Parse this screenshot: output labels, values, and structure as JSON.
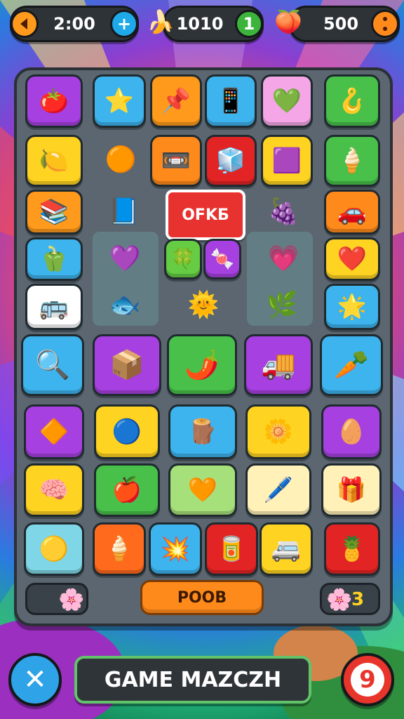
{
  "hud": {
    "timer": "2:00",
    "coins": "1010",
    "score": "500",
    "plus_symbol": "+",
    "coin_badge": "1"
  },
  "board": {
    "banner_text": "OFKБ",
    "play_button": "POOB",
    "counter_value": "3"
  },
  "footer": {
    "title": "GAME MAZCZH",
    "close_symbol": "✕",
    "right_value": "9"
  },
  "icons": [
    "tomato-icon",
    "star-icon",
    "pushpin-icon",
    "phone-icon",
    "gem-icon",
    "spring-icon",
    "lemon-icon",
    "orange-ball-icon",
    "cassette-icon",
    "cube-icon",
    "square-face-icon",
    "ice-cream-icon",
    "book-icon",
    "blue-book-icon",
    "plum-icon",
    "car-icon",
    "pepper-icon",
    "heart-outline-icon",
    "gear-face-icon",
    "candy-icon",
    "pink-heart-icon",
    "heart-icon",
    "bus-icon",
    "fish-icon",
    "sun-icon",
    "leaf-icon",
    "star-badge-icon",
    "magnifier-icon",
    "box-icon",
    "chili-icon",
    "truck-icon",
    "carrot-icon",
    "gem-icon",
    "dumbbell-icon",
    "log-icon",
    "flower-gear-icon",
    "egg-icon",
    "brain-icon",
    "apple-icon",
    "heart-pepper-icon",
    "pen-icon",
    "van-icon",
    "yellow-ball-icon",
    "cone-icon",
    "sparkle-icon",
    "roller-icon",
    "bus-icon",
    "pineapple-icon"
  ]
}
